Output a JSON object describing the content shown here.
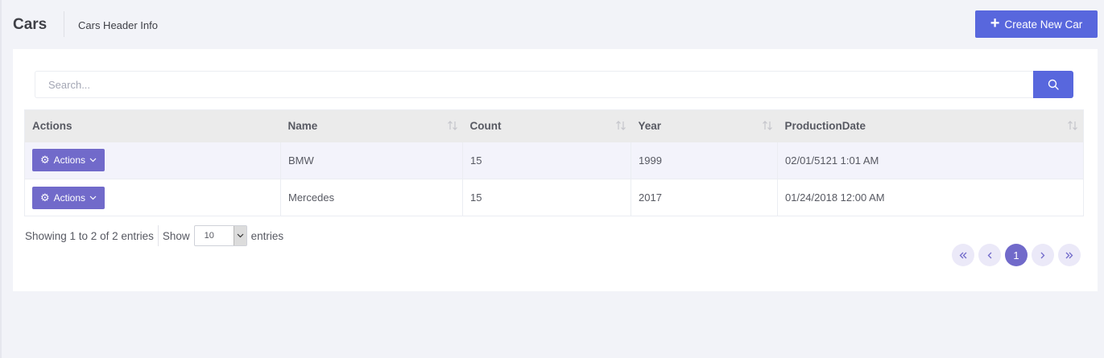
{
  "header": {
    "title": "Cars",
    "description": "Cars Header Info",
    "create_label": "Create New Car"
  },
  "search": {
    "placeholder": "Search..."
  },
  "table": {
    "columns": [
      "Actions",
      "Name",
      "Count",
      "Year",
      "ProductionDate"
    ],
    "rows": [
      {
        "action_label": "Actions",
        "name": "BMW",
        "count": "15",
        "year": "1999",
        "production_date": "02/01/5121 1:01 AM"
      },
      {
        "action_label": "Actions",
        "name": "Mercedes",
        "count": "15",
        "year": "2017",
        "production_date": "01/24/2018 12:00 AM"
      }
    ]
  },
  "footer": {
    "info": "Showing 1 to 2 of 2 entries",
    "show_label": "Show",
    "page_size": "10",
    "entries_label": "entries"
  },
  "pagination": {
    "current_page": "1"
  },
  "colors": {
    "primary": "#5867dd",
    "accent": "#716aca",
    "background": "#f2f3f8"
  }
}
